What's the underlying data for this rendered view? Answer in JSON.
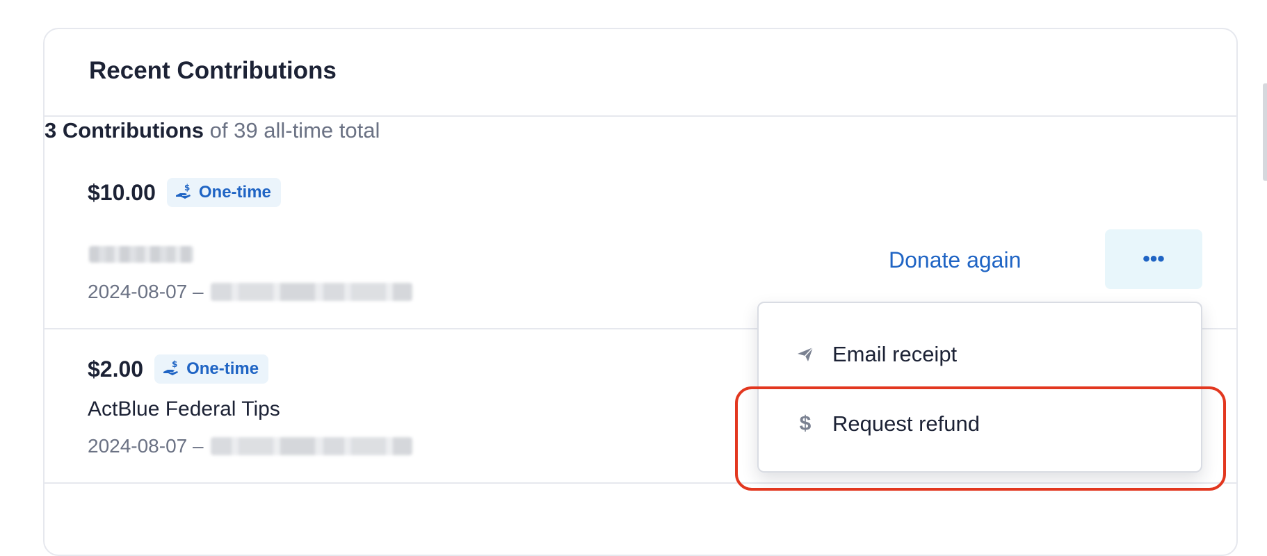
{
  "card": {
    "title": "Recent Contributions",
    "summary_count": "3 Contributions",
    "summary_rest": "of 39 all-time total"
  },
  "contributions": [
    {
      "amount": "$10.00",
      "badge": "One-time",
      "recipient": "",
      "date": "2024-08-07 –",
      "donate_again": "Donate again",
      "more": "•••"
    },
    {
      "amount": "$2.00",
      "badge": "One-time",
      "recipient": "ActBlue Federal Tips",
      "date": "2024-08-07 –"
    }
  ],
  "menu": {
    "items": [
      {
        "label": "Email receipt",
        "icon": "paper-plane-icon"
      },
      {
        "label": "Request refund",
        "icon": "dollar-icon"
      }
    ]
  },
  "colors": {
    "accent": "#1f64c4",
    "badge_bg": "#ebf4fb",
    "highlight": "#e2371f",
    "text": "#1c2235",
    "muted": "#6b7284"
  }
}
